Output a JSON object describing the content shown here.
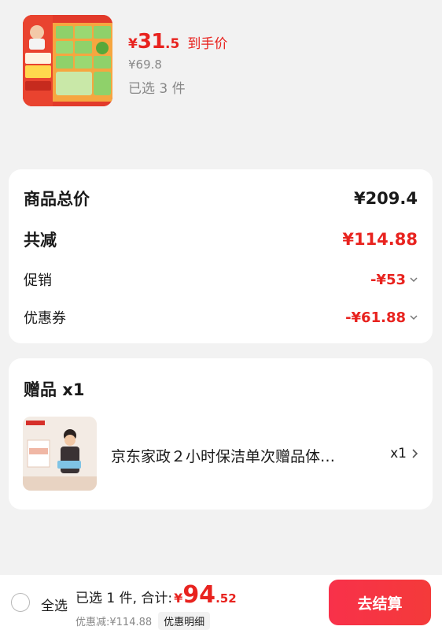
{
  "product": {
    "price_symbol": "¥",
    "price_int": "31",
    "price_dec": ".5",
    "price_tag": "到手价",
    "original_price": "¥69.8",
    "selected_count": "已选 3 件",
    "thumb_icon": "tissue-pack-image"
  },
  "summary": {
    "total_label": "商品总价",
    "total_value": "¥209.4",
    "reduce_label": "共减",
    "reduce_value": "¥114.88",
    "promo_label": "促销",
    "promo_value": "-¥53",
    "coupon_label": "优惠券",
    "coupon_value": "-¥61.88"
  },
  "gift": {
    "title": "赠品 x1",
    "name": "京东家政２小时保洁单次赠品体…",
    "qty": "x1",
    "thumb_icon": "cleaning-service-image"
  },
  "bottom_bar": {
    "select_all": "全选",
    "total_prefix": "已选 1 件, 合计:",
    "total_symbol": "¥",
    "total_int": "94",
    "total_dec": ".52",
    "discount_text": "优惠减:¥114.88",
    "detail_label": "优惠明细",
    "checkout_label": "去结算"
  },
  "colors": {
    "accent": "#e8231f",
    "background": "#f2f2f2",
    "card": "#ffffff"
  }
}
